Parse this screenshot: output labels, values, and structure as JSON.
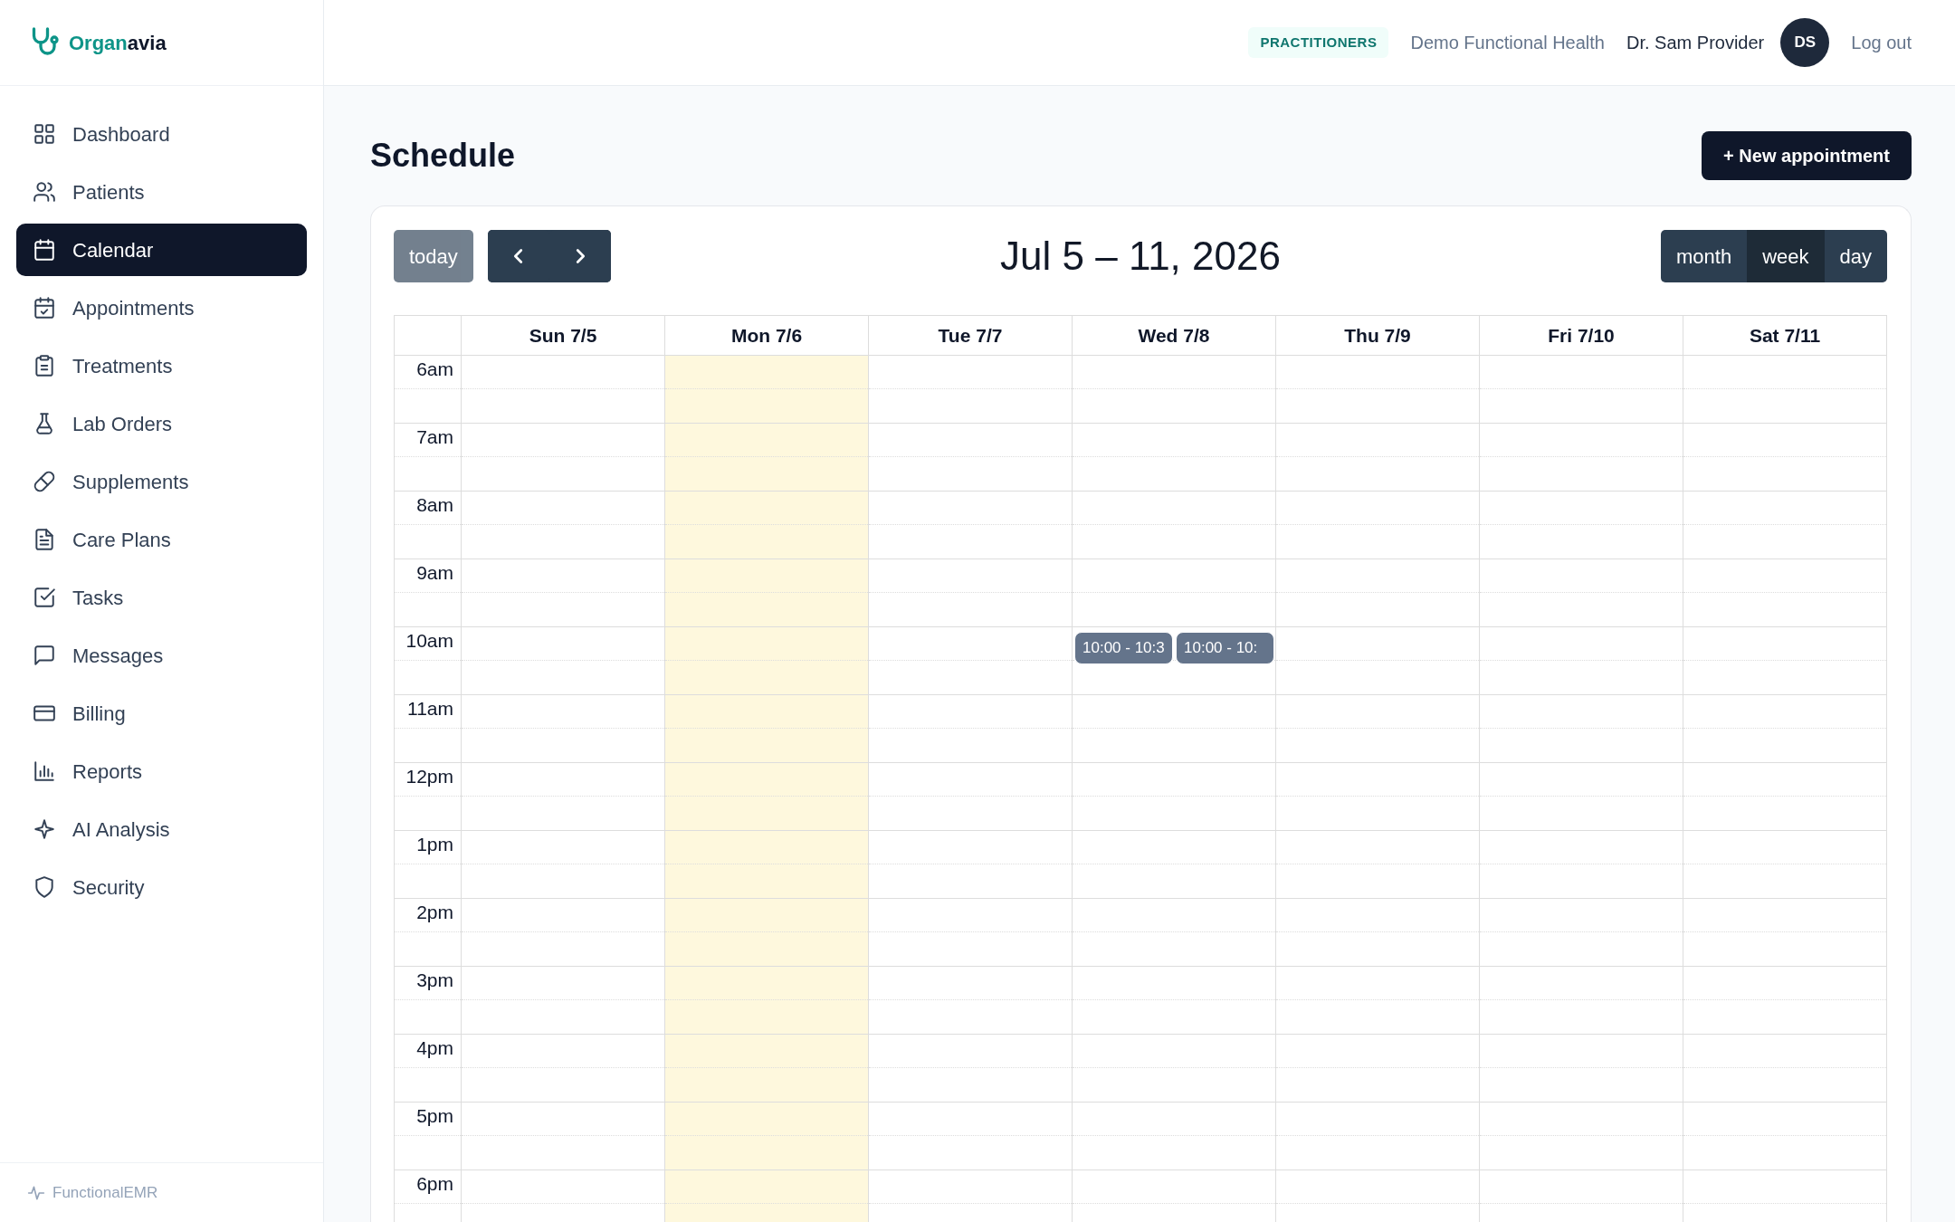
{
  "brand": {
    "part_1": "Organ",
    "part_2": "avia"
  },
  "sidebar": {
    "items": [
      {
        "label": "Dashboard",
        "selected": false
      },
      {
        "label": "Patients",
        "selected": false
      },
      {
        "label": "Calendar",
        "selected": true
      },
      {
        "label": "Appointments",
        "selected": false
      },
      {
        "label": "Treatments",
        "selected": false
      },
      {
        "label": "Lab Orders",
        "selected": false
      },
      {
        "label": "Supplements",
        "selected": false
      },
      {
        "label": "Care Plans",
        "selected": false
      },
      {
        "label": "Tasks",
        "selected": false
      },
      {
        "label": "Messages",
        "selected": false
      },
      {
        "label": "Billing",
        "selected": false
      },
      {
        "label": "Reports",
        "selected": false
      },
      {
        "label": "AI Analysis",
        "selected": false
      },
      {
        "label": "Security",
        "selected": false
      }
    ],
    "footer": "FunctionalEMR"
  },
  "header": {
    "badge": "PRACTITIONERS",
    "organization": "Demo Functional Health",
    "user": "Dr. Sam Provider",
    "avatar": "DS",
    "logout": "Log out"
  },
  "page_title": "Schedule",
  "new_button": "+ New appointment",
  "calendar": {
    "today_button": {
      "label": "today",
      "disabled": true
    },
    "title": "Jul 5 – 11, 2026",
    "views": [
      {
        "label": "month",
        "selected": false
      },
      {
        "label": "week",
        "selected": true
      },
      {
        "label": "day",
        "selected": false
      }
    ],
    "days": [
      {
        "label": "Sun 7/5",
        "today": false
      },
      {
        "label": "Mon 7/6",
        "today": true
      },
      {
        "label": "Tue 7/7",
        "today": false
      },
      {
        "label": "Wed 7/8",
        "today": false,
        "events": [
          {
            "label": "10:00 - 10:3"
          },
          {
            "label": "10:00 - 10:"
          }
        ]
      },
      {
        "label": "Thu 7/9",
        "today": false
      },
      {
        "label": "Fri 7/10",
        "today": false
      },
      {
        "label": "Sat 7/11",
        "today": false
      }
    ],
    "times": [
      "6am",
      "7am",
      "8am",
      "9am",
      "10am",
      "11am",
      "12pm",
      "1pm",
      "2pm",
      "3pm",
      "4pm",
      "5pm",
      "6pm"
    ]
  }
}
